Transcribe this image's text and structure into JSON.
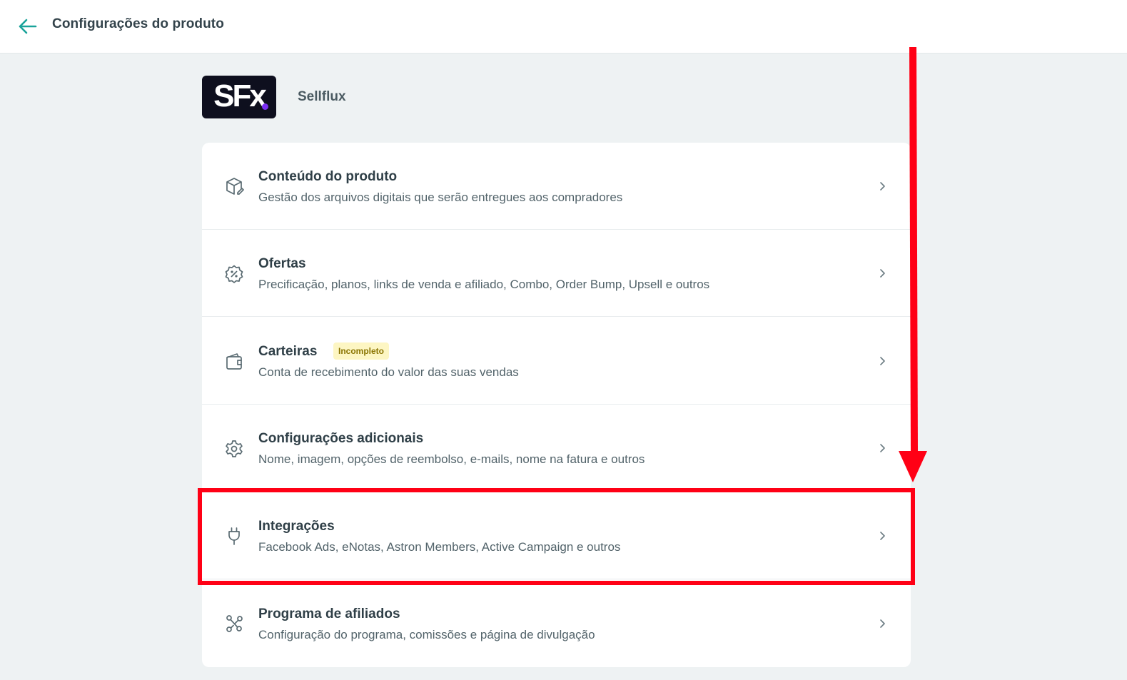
{
  "header": {
    "title": "Configurações do produto"
  },
  "product": {
    "logo_text": "SFx",
    "name": "Sellflux"
  },
  "menu": [
    {
      "title": "Conteúdo do produto",
      "description": "Gestão dos arquivos digitais que serão entregues aos compradores",
      "icon": "box-icon"
    },
    {
      "title": "Ofertas",
      "description": "Precificação, planos, links de venda e afiliado, Combo, Order Bump, Upsell e outros",
      "icon": "discount-icon"
    },
    {
      "title": "Carteiras",
      "badge": "Incompleto",
      "description": "Conta de recebimento do valor das suas vendas",
      "icon": "wallet-icon"
    },
    {
      "title": "Configurações adicionais",
      "description": "Nome, imagem, opções de reembolso, e-mails, nome na fatura e outros",
      "icon": "gear-icon"
    },
    {
      "title": "Integrações",
      "description": "Facebook Ads, eNotas, Astron Members, Active Campaign e outros",
      "icon": "plug-icon"
    },
    {
      "title": "Programa de afiliados",
      "description": "Configuração do programa, comissões e página de divulgação",
      "icon": "network-icon"
    }
  ],
  "colors": {
    "accent": "#1aa39a",
    "annotation": "#ff0015",
    "badge_bg": "#fdf6c3",
    "badge_text": "#8a7400"
  }
}
